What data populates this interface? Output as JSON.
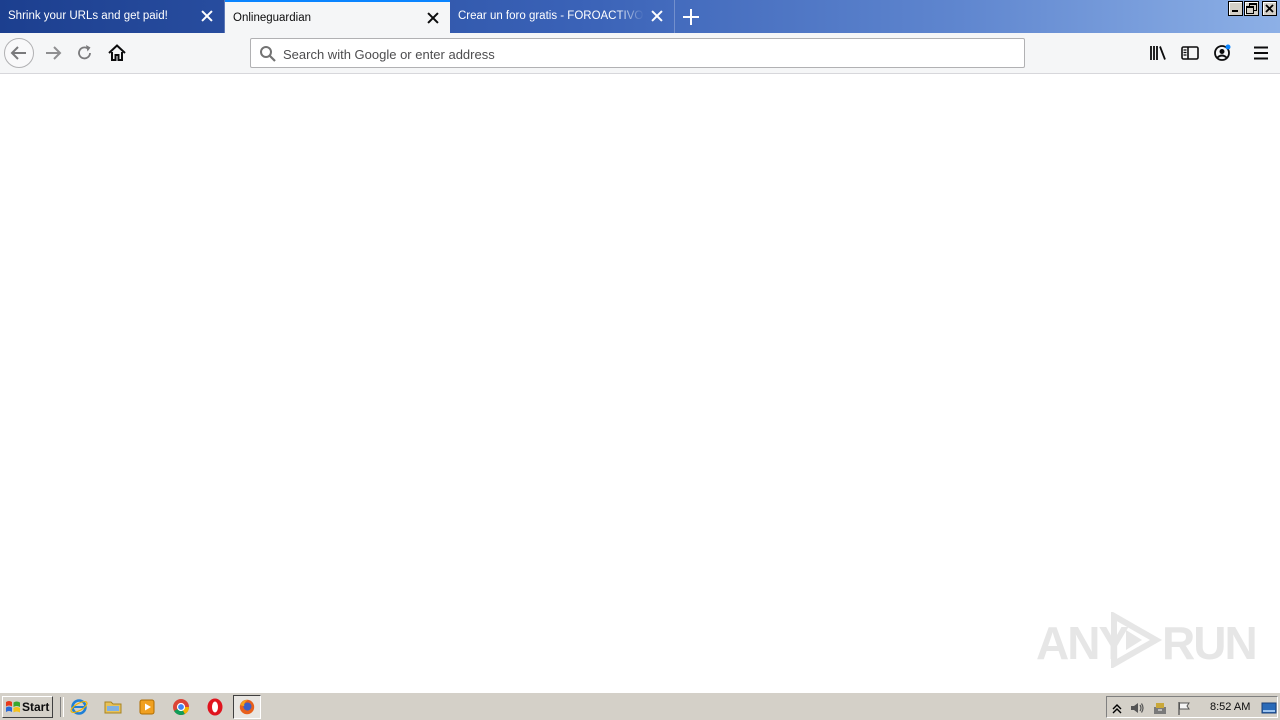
{
  "browser": {
    "tabs": [
      {
        "label": "Shrink your URLs and get paid!",
        "active": false
      },
      {
        "label": "Onlineguardian",
        "active": true
      },
      {
        "label": "Crear un foro gratis - FOROACTIVO.COM",
        "active": false
      }
    ],
    "address_bar": {
      "placeholder": "Search with Google or enter address",
      "value": ""
    }
  },
  "watermark": {
    "left": "ANY",
    "right": "RUN"
  },
  "taskbar": {
    "start_label": "Start",
    "clock": "8:52 AM",
    "apps": [
      "internet-explorer",
      "file-explorer",
      "media-player",
      "chrome",
      "opera",
      "firefox"
    ]
  },
  "colors": {
    "accent": "#0a84ff",
    "titlebar_start": "#1c3f8f",
    "titlebar_end": "#8db0e6"
  }
}
